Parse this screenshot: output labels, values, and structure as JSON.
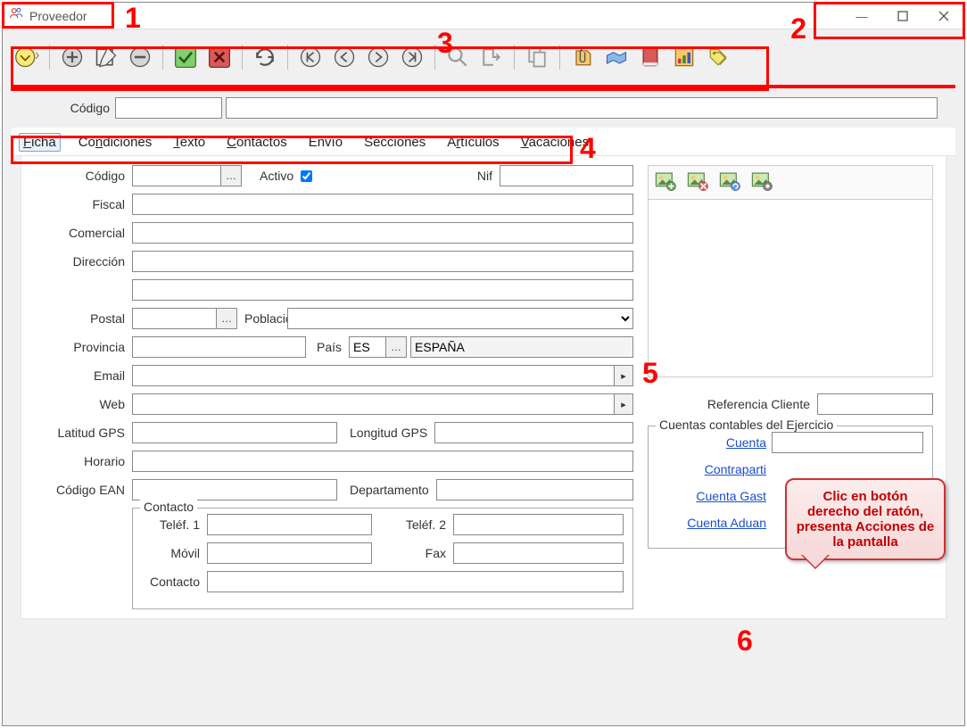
{
  "window": {
    "title": "Proveedor"
  },
  "toolbar": {
    "codigo_label": "Código"
  },
  "tabs": [
    {
      "label_pre": "",
      "u": "F",
      "label_post": "icha",
      "active": true
    },
    {
      "label_pre": "Co",
      "u": "n",
      "label_post": "diciones"
    },
    {
      "label_pre": "",
      "u": "T",
      "label_post": "exto"
    },
    {
      "label_pre": "",
      "u": "C",
      "label_post": "ontactos"
    },
    {
      "label_pre": "Envío",
      "u": "",
      "label_post": ""
    },
    {
      "label_pre": "Secciones",
      "u": "",
      "label_post": ""
    },
    {
      "label_pre": "A",
      "u": "r",
      "label_post": "tículos"
    },
    {
      "label_pre": "",
      "u": "V",
      "label_post": "acaciones"
    }
  ],
  "ficha": {
    "codigo_label": "Código",
    "activo_label": "Activo",
    "activo_checked": true,
    "nif_label": "Nif",
    "fiscal_label": "Fiscal",
    "comercial_label": "Comercial",
    "direccion_label": "Dirección",
    "postal_label": "Postal",
    "poblacion_label": "Población",
    "provincia_label": "Provincia",
    "pais_label": "País",
    "pais_value": "ES",
    "pais_name": "ESPAÑA",
    "email_label": "Email",
    "web_label": "Web",
    "lat_label": "Latitud GPS",
    "lon_label": "Longitud GPS",
    "horario_label": "Horario",
    "ean_label": "Código EAN",
    "depto_label": "Departamento",
    "contacto_legend": "Contacto",
    "telef1_label": "Teléf. 1",
    "telef2_label": "Teléf. 2",
    "movil_label": "Móvil",
    "fax_label": "Fax",
    "contacto_label": "Contacto"
  },
  "right": {
    "ref_cliente_label": "Referencia Cliente",
    "cuentas_legend": "Cuentas contables del Ejercicio",
    "cuenta_link": "Cuenta",
    "contrapartida_link": "Contraparti",
    "cuenta_gasto_link": "Cuenta Gast",
    "cuenta_aduana_link": "Cuenta Aduan"
  },
  "callout": {
    "text": "Clic en botón derecho del ratón, presenta Acciones de la pantalla"
  },
  "annotations": {
    "n1": "1",
    "n2": "2",
    "n3": "3",
    "n4": "4",
    "n5": "5",
    "n6": "6"
  }
}
